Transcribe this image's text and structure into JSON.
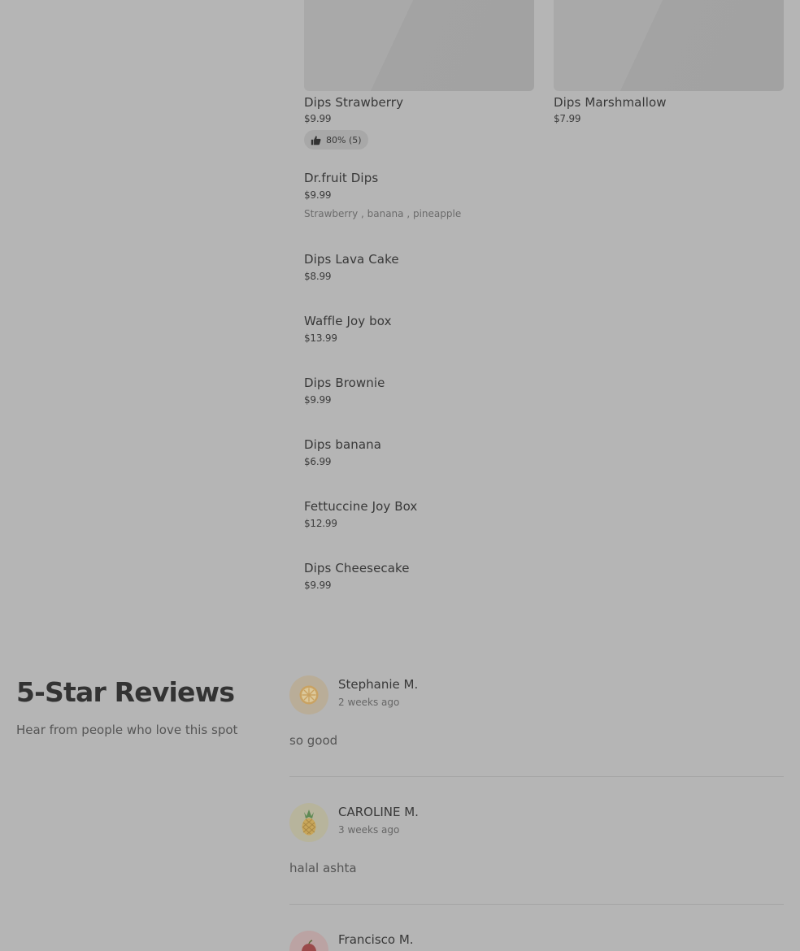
{
  "featured": [
    {
      "name": "Dips Strawberry",
      "price": "$9.99",
      "rating": "80% (5)"
    },
    {
      "name": "Dips Marshmallow",
      "price": "$7.99"
    }
  ],
  "menu_items": [
    {
      "name": "Dr.fruit Dips",
      "price": "$9.99",
      "description": "Strawberry , banana , pineapple"
    },
    {
      "name": "Dips Lava Cake",
      "price": "$8.99"
    },
    {
      "name": "Waffle Joy box",
      "price": "$13.99"
    },
    {
      "name": "Dips Brownie",
      "price": "$9.99"
    },
    {
      "name": "Dips banana",
      "price": "$6.99"
    },
    {
      "name": "Fettuccine Joy Box",
      "price": "$12.99"
    },
    {
      "name": "Dips Cheesecake",
      "price": "$9.99"
    }
  ],
  "reviews_section": {
    "title": "5-Star Reviews",
    "subtitle": "Hear from people who love this spot"
  },
  "reviews": [
    {
      "name": "Stephanie M.",
      "time": "2 weeks ago",
      "text": "so good",
      "avatar_icon": "orange-slice-icon",
      "avatar_bg": "#b9ad98"
    },
    {
      "name": "CAROLINE M.",
      "time": "3 weeks ago",
      "text": "halal ashta",
      "avatar_icon": "pineapple-icon",
      "avatar_bg": "#b7b49c"
    },
    {
      "name": "Francisco M.",
      "avatar_icon": "fruit-icon",
      "avatar_bg": "#bba3a3"
    }
  ]
}
